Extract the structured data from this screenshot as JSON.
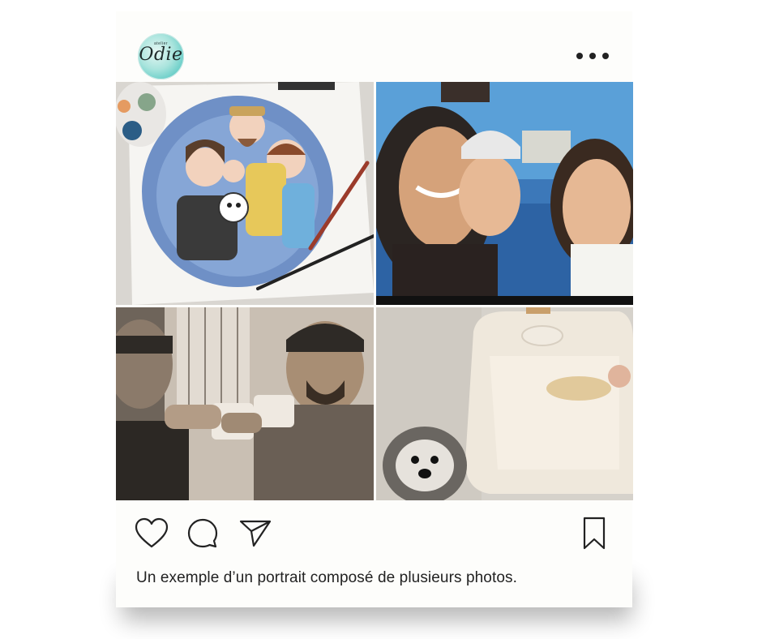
{
  "post": {
    "account_logo_text": "Odie",
    "account_logo_small": "atelier",
    "more_icon": "more-horizontal-icon",
    "photos": [
      {
        "name": "photo-watercolor-family-portrait"
      },
      {
        "name": "photo-family-selfie-pool"
      },
      {
        "name": "photo-coffee-toast"
      },
      {
        "name": "photo-dog-high-chair"
      }
    ],
    "actions": {
      "like_icon": "heart-icon",
      "comment_icon": "comment-icon",
      "share_icon": "send-icon",
      "save_icon": "bookmark-icon"
    },
    "caption": "Un exemple d’un portrait composé de plusieurs photos."
  }
}
